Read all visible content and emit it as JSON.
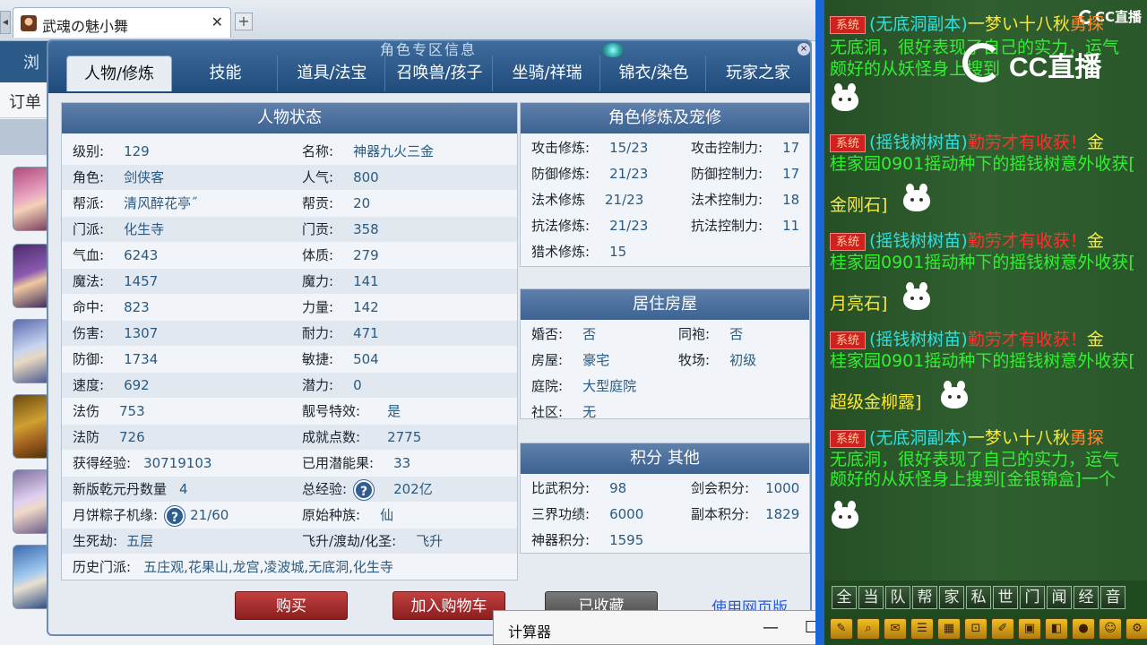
{
  "browser": {
    "tab_title": "武魂の魅小舞",
    "tab_close": "✕",
    "new_tab": "+",
    "scroll_arrow": "◀",
    "nav_label": "浏",
    "order_label": "订单"
  },
  "panel": {
    "title": "角色专区信息",
    "tabs": [
      "人物/修炼",
      "技能",
      "道具/法宝",
      "召唤兽/孩子",
      "坐骑/祥瑞",
      "锦衣/染色",
      "玩家之家"
    ]
  },
  "status": {
    "title": "人物状态",
    "left": [
      {
        "label": "级别:",
        "value": "129"
      },
      {
        "label": "角色:",
        "value": "剑侠客"
      },
      {
        "label": "帮派:",
        "value": "清风醉花亭˝"
      },
      {
        "label": "门派:",
        "value": "化生寺"
      },
      {
        "label": "气血:",
        "value": "6243"
      },
      {
        "label": "魔法:",
        "value": "1457"
      },
      {
        "label": "命中:",
        "value": "823"
      },
      {
        "label": "伤害:",
        "value": "1307"
      },
      {
        "label": "防御:",
        "value": "1734"
      },
      {
        "label": "速度:",
        "value": "692"
      },
      {
        "label": "法伤",
        "value": "753"
      },
      {
        "label": "法防",
        "value": "726"
      },
      {
        "label": "获得经验:",
        "value": "30719103"
      },
      {
        "label": "新版乾元丹数量",
        "value": "4"
      },
      {
        "label": "月饼粽子机缘:",
        "value": "21/60"
      },
      {
        "label": "生死劫:",
        "value": "五层"
      }
    ],
    "right": [
      {
        "label": "名称:",
        "value": "神器九火三金"
      },
      {
        "label": "人气:",
        "value": "800"
      },
      {
        "label": "帮贡:",
        "value": "20"
      },
      {
        "label": "门贡:",
        "value": "358"
      },
      {
        "label": "体质:",
        "value": "279"
      },
      {
        "label": "魔力:",
        "value": "141"
      },
      {
        "label": "力量:",
        "value": "142"
      },
      {
        "label": "耐力:",
        "value": "471"
      },
      {
        "label": "敏捷:",
        "value": "504"
      },
      {
        "label": "潜力:",
        "value": "0"
      },
      {
        "label": "靓号特效:",
        "value": "是"
      },
      {
        "label": "成就点数:",
        "value": "2775"
      },
      {
        "label": "已用潜能果:",
        "value": "33"
      },
      {
        "label": "总经验:",
        "value": "202亿"
      },
      {
        "label": "原始种族:",
        "value": "仙"
      },
      {
        "label": "飞升/渡劫/化圣:",
        "value": "飞升"
      }
    ],
    "history_label": "历史门派:",
    "history_value": "五庄观,花果山,龙宫,凌波城,无底洞,化生寺",
    "help_glyph": "?"
  },
  "training": {
    "title": "角色修炼及宠修",
    "left": [
      {
        "label": "攻击修炼:",
        "value": "15/23"
      },
      {
        "label": "防御修炼:",
        "value": "21/23"
      },
      {
        "label": "法术修炼",
        "value": "21/23"
      },
      {
        "label": "抗法修炼:",
        "value": "21/23"
      },
      {
        "label": "猎术修炼:",
        "value": "15"
      }
    ],
    "right": [
      {
        "label": "攻击控制力:",
        "value": "17"
      },
      {
        "label": "防御控制力:",
        "value": "17"
      },
      {
        "label": "法术控制力:",
        "value": "18"
      },
      {
        "label": "抗法控制力:",
        "value": "11"
      }
    ]
  },
  "house": {
    "title": "居住房屋",
    "rows": [
      {
        "label": "婚否:",
        "value": "否",
        "label2": "同袍:",
        "value2": "否"
      },
      {
        "label": "房屋:",
        "value": "豪宅",
        "label2": "牧场:",
        "value2": "初级"
      },
      {
        "label": "庭院:",
        "value": "大型庭院"
      },
      {
        "label": "社区:",
        "value": "无"
      }
    ]
  },
  "score": {
    "title": "积分 其他",
    "rows": [
      {
        "label": "比武积分:",
        "value": "98",
        "label2": "剑会积分:",
        "value2": "1000"
      },
      {
        "label": "三界功绩:",
        "value": "6000",
        "label2": "副本积分:",
        "value2": "1829"
      },
      {
        "label": "神器积分:",
        "value": "1595"
      }
    ]
  },
  "actions": {
    "buy": "购买",
    "add_cart": "加入购物车",
    "favorited": "已收藏",
    "web_version": "使用网页版"
  },
  "calculator": {
    "title": "计算器",
    "minimize": "—",
    "maximize": "☐",
    "close": "✕"
  },
  "chat": {
    "logo_text": "CC直播",
    "mini_logo": "CC直播",
    "sys_tag": "系统",
    "messages": [
      {
        "source": "(无底洞副本)",
        "player": "一梦い十八秋",
        "verb": "勇探",
        "body1": "无底洞，很好表现了自己的实力，运气",
        "body2": "颇好的从妖怪身上搜到"
      },
      {
        "source": "(摇钱树树苗)",
        "exclaim": "勤劳才有收获！",
        "name_end": "金",
        "body1": "桂家园0901摇动种下的摇钱树意外收获[",
        "item": "金刚石]"
      },
      {
        "source": "(摇钱树树苗)",
        "exclaim": "勤劳才有收获！",
        "name_end": "金",
        "body1": "桂家园0901摇动种下的摇钱树意外收获[",
        "item": "月亮石]"
      },
      {
        "source": "(摇钱树树苗)",
        "exclaim": "勤劳才有收获！",
        "name_end": "金",
        "body1": "桂家园0901摇动种下的摇钱树意外收获[",
        "item": "超级金柳露]"
      },
      {
        "source": "(无底洞副本)",
        "player": "一梦い十八秋",
        "verb": "勇探",
        "body1": "无底洞，很好表现了自己的实力，运气",
        "body2": "颇好的从妖怪身上搜到[金银锦盒]一个"
      }
    ],
    "channels": [
      "全",
      "当",
      "队",
      "帮",
      "家",
      "私",
      "世",
      "门",
      "闻",
      "经",
      "音"
    ]
  }
}
